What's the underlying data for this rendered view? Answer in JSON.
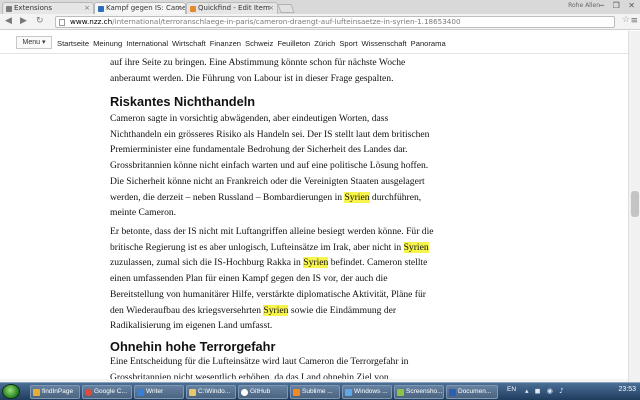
{
  "browser": {
    "tabs": [
      {
        "title": "Extensions",
        "fav_color": "#7a7a7a"
      },
      {
        "title": "Kampf gegen IS: Cameron",
        "fav_color": "#2a6dbd"
      },
      {
        "title": "Quickfind - Edit Item",
        "fav_color": "#e58a2b"
      }
    ],
    "user_label": "Rohe Allen",
    "back_icon": "back-arrow-icon",
    "forward_icon": "forward-arrow-icon",
    "reload_icon": "reload-icon",
    "url_host": "www.nzz.ch",
    "url_path": "/international/terroranschlaege-in-paris/cameron-draengt-auf-lufteinsaetze-in-syrien-1.18653400"
  },
  "site_nav": {
    "menu_label": "Menu ▾",
    "links": [
      "Startseite",
      "Meinung",
      "International",
      "Wirtschaft",
      "Finanzen",
      "Schweiz",
      "Feuilleton",
      "Zürich",
      "Sport",
      "Wissenschaft",
      "Panorama"
    ]
  },
  "article": {
    "p0": "auf ihre Seite zu bringen. Eine Abstimmung könnte schon für nächste Woche anberaumt werden. Die Führung von Labour ist in dieser Frage gespalten.",
    "h_riskantes": "Riskantes Nichthandeln",
    "p1": {
      "before": "Cameron sagte in vorsichtig abwägenden, aber eindeutigen Worten, dass Nichthandeln ein grösseres Risiko als Handeln sei. Der IS stellt laut dem britischen Premierminister eine fundamentale Bedrohung der Sicherheit des Landes dar. Grossbritannien könne nicht einfach warten und auf eine politische Lösung hoffen. Die Sicherheit könne nicht an Frankreich oder die Vereinigten Staaten ausgelagert werden, die derzeit – neben Russland – Bombardierungen in ",
      "hl": "Syrien",
      "after": " durchführen, meinte Cameron."
    },
    "p2": {
      "s1": "Er betonte, dass der IS nicht mit Luftangriffen alleine besiegt werden könne. Für die britische Regierung ist es aber unlogisch, Lufteinsätze im Irak, aber nicht in ",
      "hl1": "Syrien",
      "s2": " zuzulassen, zumal sich die IS-Hochburg Rakka in ",
      "hl2": "Syrien",
      "s3": " befindet. Cameron stellte einen umfassenden Plan für einen Kampf gegen den IS vor, der auch die Bereitstellung von humanitärer Hilfe, verstärkte diplomatische Aktivität, Pläne für den Wiederaufbau des kriegsversehrten ",
      "hl3": "Syrien",
      "s4": " sowie die Eindämmung der Radikalisierung im eigenen Land umfasst."
    },
    "h_ohnehin": "Ohnehin hohe Terrorgefahr",
    "p3": "Eine Entscheidung für die Lufteinsätze wird laut Cameron die Terrorgefahr in Grossbritannien nicht wesentlich erhöhen, da das Land ohnehin Ziel von",
    "highlight_color": "#f7f44c"
  },
  "taskbar": {
    "buttons": [
      {
        "label": "findInPage",
        "color": "#e2b03a"
      },
      {
        "label": "Google C...",
        "color": "#e04a3a"
      },
      {
        "label": "Writer",
        "color": "#3a7fd1"
      },
      {
        "label": "C:\\Windo...",
        "color": "#e7c86a"
      },
      {
        "label": "GitHub",
        "color": "#ffffff"
      },
      {
        "label": "Sublime ...",
        "color": "#f08a24"
      },
      {
        "label": "Windows ...",
        "color": "#5fa8e8"
      },
      {
        "label": "Screensho...",
        "color": "#8bc34a"
      },
      {
        "label": "Documen...",
        "color": "#2b5fb4"
      }
    ],
    "lang": "EN",
    "clock": "23:53"
  }
}
